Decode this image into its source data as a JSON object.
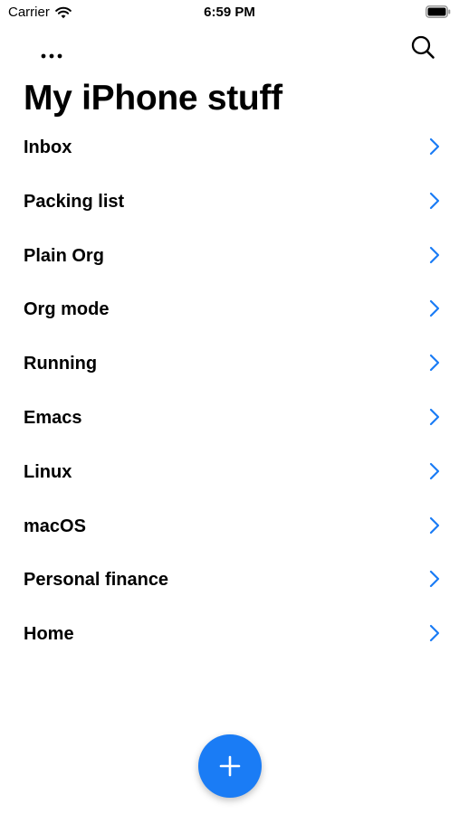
{
  "status_bar": {
    "carrier": "Carrier",
    "time": "6:59 PM"
  },
  "nav": {
    "more_icon": "ellipsis-icon",
    "search_icon": "magnifier-icon"
  },
  "page": {
    "title": "My iPhone stuff"
  },
  "list": {
    "items": [
      {
        "label": "Inbox"
      },
      {
        "label": "Packing list"
      },
      {
        "label": "Plain Org"
      },
      {
        "label": "Org mode"
      },
      {
        "label": "Running"
      },
      {
        "label": "Emacs"
      },
      {
        "label": "Linux"
      },
      {
        "label": "macOS"
      },
      {
        "label": "Personal finance"
      },
      {
        "label": "Home"
      }
    ]
  },
  "fab": {
    "icon": "plus-icon"
  },
  "colors": {
    "accent": "#1a7cf5",
    "text": "#000000",
    "background": "#ffffff"
  }
}
